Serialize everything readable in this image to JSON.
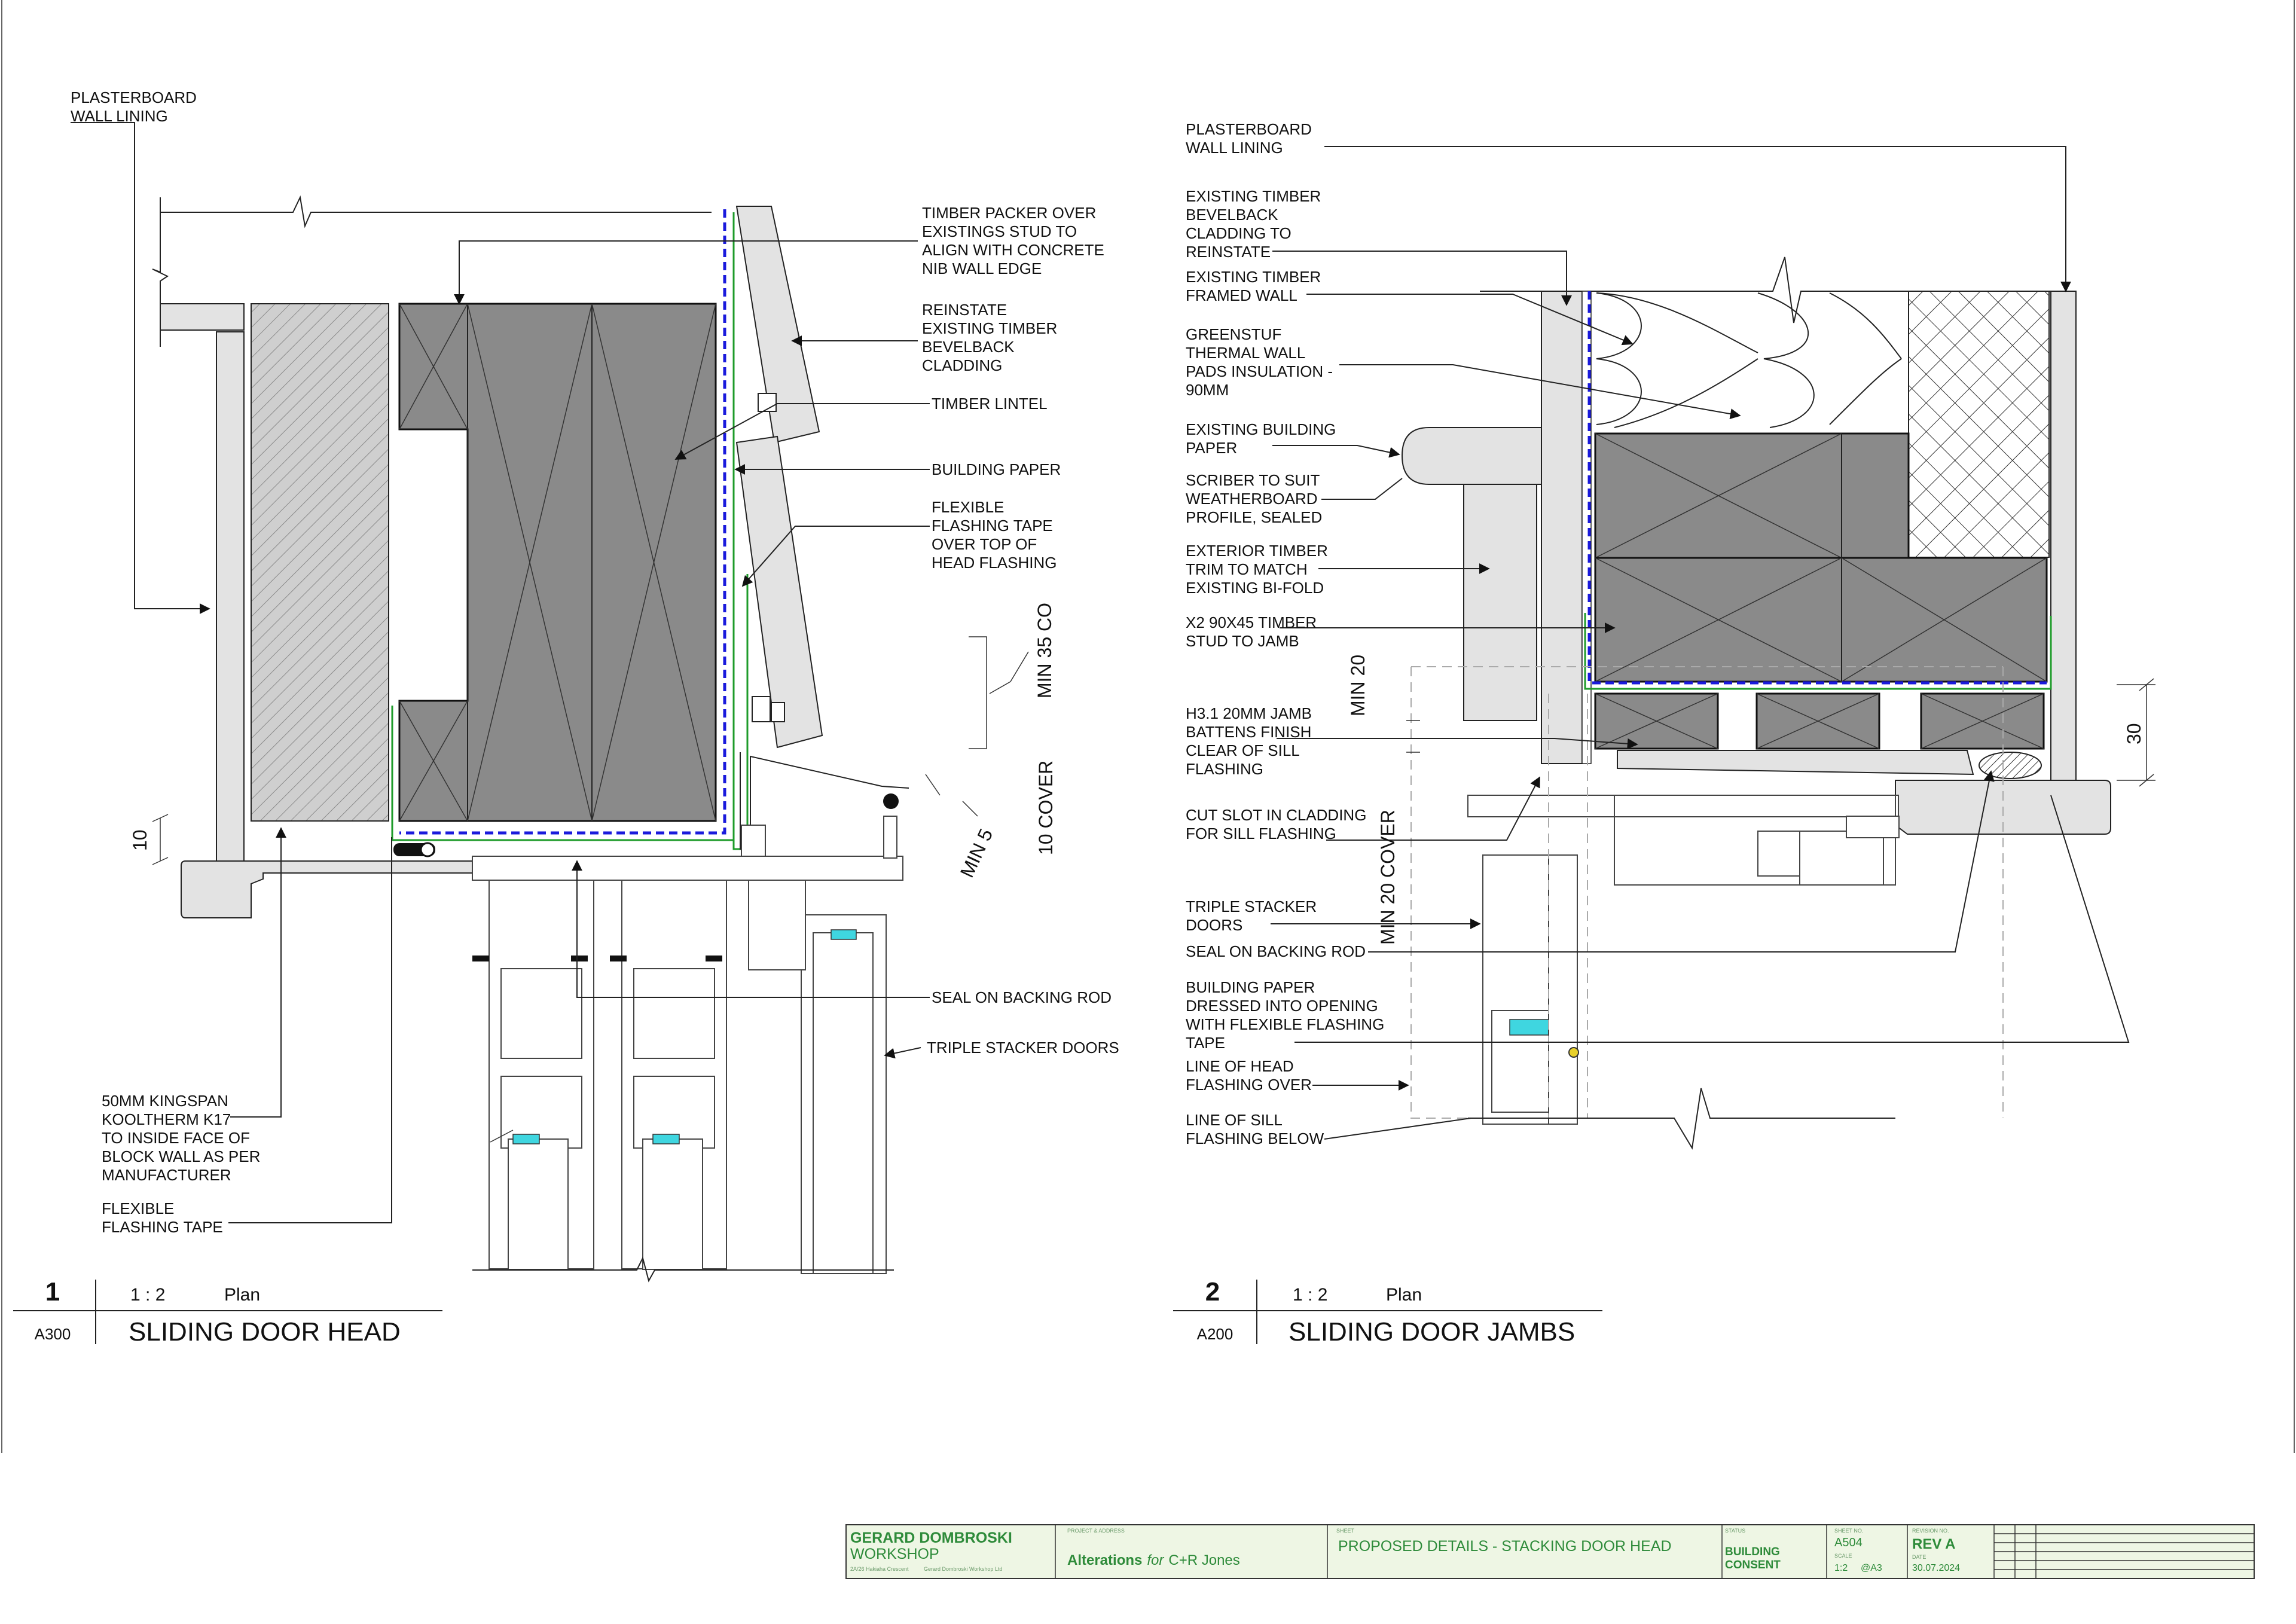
{
  "detail1": {
    "number": "1",
    "scale": "1 : 2",
    "view": "Plan",
    "sheet_ref": "A300",
    "title": "SLIDING DOOR HEAD",
    "labels": {
      "plasterboard": [
        "PLASTERBOARD",
        "WALL LINING"
      ],
      "timber_packer": [
        "TIMBER PACKER OVER",
        "EXISTINGS STUD TO",
        "ALIGN WITH CONCRETE",
        "NIB WALL EDGE"
      ],
      "reinstate": [
        "REINSTATE",
        "EXISTING TIMBER",
        "BEVELBACK",
        "CLADDING"
      ],
      "lintel": [
        "TIMBER LINTEL"
      ],
      "building_paper": [
        "BUILDING PAPER"
      ],
      "flashing_tape_top": [
        "FLEXIBLE",
        "FLASHING TAPE",
        "OVER TOP OF",
        "HEAD FLASHING"
      ],
      "seal": [
        "SEAL ON BACKING ROD"
      ],
      "triple": [
        "TRIPLE STACKER DOORS"
      ],
      "kingspan": [
        "50MM KINGSPAN",
        "KOOLTHERM K17",
        "TO INSIDE FACE OF",
        "BLOCK WALL AS PER",
        "MANUFACTURER"
      ],
      "flashing_tape": [
        "FLEXIBLE",
        "FLASHING TAPE"
      ]
    },
    "dims": {
      "min35": "MIN 35 CO",
      "min5": "MIN 5",
      "cover10": "10 COVER",
      "ten": "10"
    }
  },
  "detail2": {
    "number": "2",
    "scale": "1 : 2",
    "view": "Plan",
    "sheet_ref": "A200",
    "title": "SLIDING DOOR JAMBS",
    "labels": {
      "plasterboard": [
        "PLASTERBOARD",
        "WALL LINING"
      ],
      "bevelback": [
        "EXISTING TIMBER",
        "BEVELBACK",
        "CLADDING TO",
        "REINSTATE"
      ],
      "framed_wall": [
        "EXISTING TIMBER",
        "FRAMED WALL"
      ],
      "greenstuf": [
        "GREENSTUF",
        "THERMAL WALL",
        "PADS INSULATION -",
        "90MM"
      ],
      "building_paper": [
        "EXISTING BUILDING",
        "PAPER"
      ],
      "scriber": [
        "SCRIBER TO SUIT",
        "WEATHERBOARD",
        "PROFILE, SEALED"
      ],
      "trim": [
        "EXTERIOR TIMBER",
        "TRIM TO MATCH",
        "EXISTING BI-FOLD"
      ],
      "stud": [
        "X2 90X45 TIMBER",
        "STUD TO JAMB"
      ],
      "battens": [
        "H3.1 20MM JAMB",
        "BATTENS FINISH",
        "CLEAR OF SILL",
        "FLASHING"
      ],
      "cut_slot": [
        "CUT SLOT IN CLADDING",
        "FOR SILL FLASHING"
      ],
      "triple": [
        "TRIPLE STACKER",
        "DOORS"
      ],
      "seal": [
        "SEAL ON BACKING ROD"
      ],
      "paper_dressed": [
        "BUILDING PAPER",
        "DRESSED INTO OPENING",
        "WITH FLEXIBLE FLASHING",
        "TAPE"
      ],
      "head_flashing": [
        "LINE OF HEAD",
        "FLASHING OVER"
      ],
      "sill_flashing": [
        "LINE OF SILL",
        "FLASHING BELOW"
      ]
    },
    "dims": {
      "min20": "MIN 20",
      "min20cover": "MIN 20 COVER",
      "thirty": "30"
    }
  },
  "title_block": {
    "company": "GERARD DOMBROSKI",
    "company_sub": "WORKSHOP",
    "company_small": [
      "2A/26 Hakiaha Crescent",
      "Gerard Dombroski Workshop Ltd"
    ],
    "project_caption": "PROJECT & ADDRESS",
    "project_prefix": "Alterations",
    "project_for": "for",
    "project_name": "C+R Jones",
    "sheet_caption": "SHEET",
    "sheet_title": "PROPOSED DETAILS - STACKING DOOR HEAD",
    "status_caption": "STATUS",
    "status": [
      "BUILDING",
      "CONSENT"
    ],
    "sheet_no_caption": "SHEET NO.",
    "sheet_no": "A504",
    "scale_caption": "SCALE",
    "scale": "1:2",
    "paper": "@A3",
    "revision_caption": "REVISION NO.",
    "revision": "REV A",
    "date_caption": "DATE",
    "date": "30.07.2024"
  },
  "colors": {
    "accent": "#2e8b3a",
    "flashing": "#1e9b2a",
    "paper": "#1a1adc",
    "seal": "#3fd6e0"
  }
}
